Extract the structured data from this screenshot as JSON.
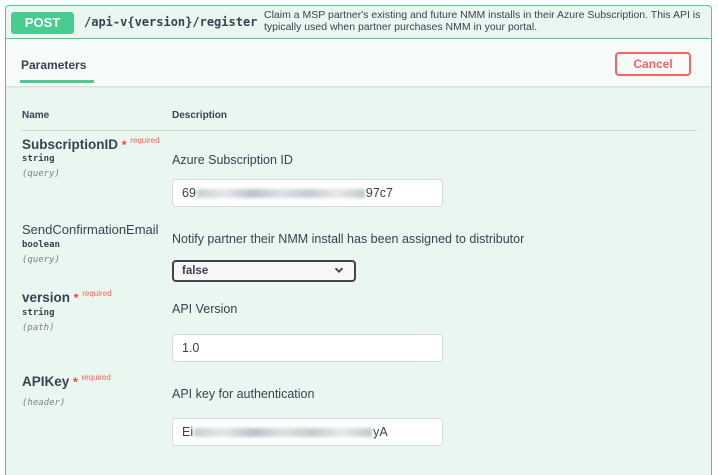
{
  "operation": {
    "method": "POST",
    "path": "/api-v{version}/register",
    "summary": "Claim a MSP partner's existing and future NMM installs in their Azure Subscription. This API is typically used when partner purchases NMM in your portal."
  },
  "parameters_panel": {
    "tab_label": "Parameters",
    "cancel_label": "Cancel",
    "col_name": "Name",
    "col_description": "Description",
    "required_star": "*",
    "required_label": "required"
  },
  "params": [
    {
      "name": "SubscriptionID",
      "type": "string",
      "in": "(query)",
      "required": true,
      "description": "Azure Subscription ID",
      "value_prefix": "69",
      "value_suffix": "97c7"
    },
    {
      "name": "SendConfirmationEmail",
      "type": "boolean",
      "in": "(query)",
      "required": false,
      "description": "Notify partner their NMM install has been assigned to distributor",
      "selected": "false"
    },
    {
      "name": "version",
      "type": "string",
      "in": "(path)",
      "required": true,
      "description": "API Version",
      "value": "1.0"
    },
    {
      "name": "APIKey",
      "in": "(header)",
      "required": true,
      "description": "API key for authentication",
      "value_prefix": "Ei",
      "value_suffix": "yA"
    }
  ],
  "colors": {
    "post_green": "#49cc90",
    "panel_bg": "#eaf6f0",
    "cancel_red": "#ff6060",
    "required_red": "#ff3b3b"
  },
  "icons": {
    "select_arrow": "chevron-down-icon"
  }
}
